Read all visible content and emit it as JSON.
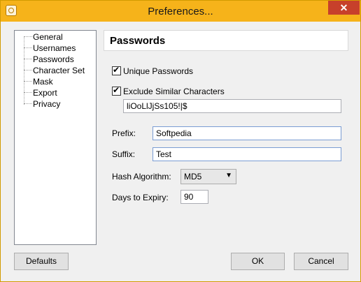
{
  "window": {
    "title": "Preferences...",
    "close_glyph": "✕"
  },
  "sidebar": {
    "items": [
      {
        "label": "General"
      },
      {
        "label": "Usernames"
      },
      {
        "label": "Passwords"
      },
      {
        "label": "Character Set"
      },
      {
        "label": "Mask"
      },
      {
        "label": "Export"
      },
      {
        "label": "Privacy"
      }
    ]
  },
  "panel": {
    "title": "Passwords",
    "unique_passwords": {
      "label": "Unique Passwords",
      "checked": true
    },
    "exclude_similar": {
      "label": "Exclude Similar Characters",
      "checked": true,
      "value": "liOoLlJjSs105!|$"
    },
    "prefix": {
      "label": "Prefix:",
      "value": "Softpedia"
    },
    "suffix": {
      "label": "Suffix:",
      "value": "Test"
    },
    "hash": {
      "label": "Hash Algorithm:",
      "value": "MD5"
    },
    "expiry": {
      "label": "Days to Expiry:",
      "value": "90"
    }
  },
  "buttons": {
    "defaults": "Defaults",
    "ok": "OK",
    "cancel": "Cancel"
  },
  "icons": {
    "app": "app-icon",
    "close": "close-icon",
    "dropdown": "chevron-down-icon"
  }
}
